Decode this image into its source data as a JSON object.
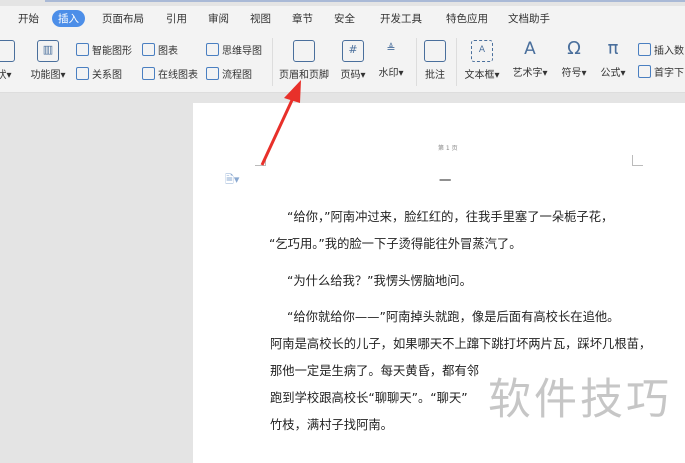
{
  "tabs": [
    "开始",
    "插入",
    "页面布局",
    "引用",
    "审阅",
    "视图",
    "章节",
    "安全",
    "开发工具",
    "特色应用",
    "文档助手"
  ],
  "active_tab": "插入",
  "ribbon": {
    "shape": "状",
    "func": "功能图",
    "smart": "智能图形",
    "chart": "图表",
    "mind": "思维导图",
    "relation": "关系图",
    "online_chart": "在线图表",
    "flow": "流程图",
    "header_footer": "页眉和页脚",
    "page_num": "页码",
    "watermark": "水印",
    "comment": "批注",
    "textbox": "文本框",
    "wordart": "艺术字",
    "symbol": "符号",
    "formula": "公式",
    "insert_num": "插入数",
    "dropcap": "首字下"
  },
  "page": {
    "header": "第 1 页",
    "heading": "一",
    "lines": [
      "“给你，”阿南冲过来，脸红红的，往我手里塞了一朵栀子花，",
      "“乞巧用。”我的脸一下子烫得能往外冒蒸汽了。",
      "“为什么给我？”我愣头愣脑地问。",
      "“给你就给你——”阿南掉头就跑，像是后面有高校长在追他。",
      "阿南是高校长的儿子，如果哪天不上蹿下跳打坏两片瓦，踩坏几根苗，",
      "那他一定是生病了。每天黄昏，都有邻",
      "跑到学校跟高校长“聊聊天”。“聊天”",
      "竹枝，满村子找阿南。"
    ]
  },
  "watermark_text": "软件技巧",
  "colors": {
    "accent": "#4c8ee8",
    "arrow": "#e8302a"
  }
}
